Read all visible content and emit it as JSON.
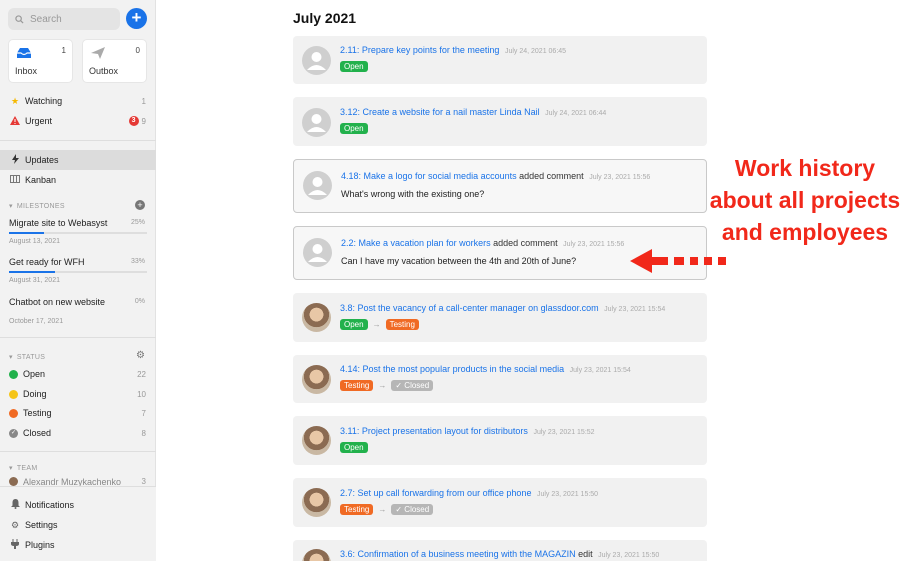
{
  "sidebar": {
    "search_placeholder": "Search",
    "add_label": "+",
    "inbox": {
      "label": "Inbox",
      "count": "1"
    },
    "outbox": {
      "label": "Outbox",
      "count": "0"
    },
    "watching": {
      "label": "Watching",
      "count": "1"
    },
    "urgent": {
      "label": "Urgent",
      "badge": "3",
      "count": "9"
    },
    "updates": {
      "label": "Updates"
    },
    "kanban": {
      "label": "Kanban"
    },
    "milestones_header": "MILESTONES",
    "milestones": [
      {
        "name": "Migrate site to Webasyst",
        "percent": "25%",
        "progress": 0.25,
        "date": "August 13, 2021"
      },
      {
        "name": "Get ready for WFH",
        "percent": "33%",
        "progress": 0.33,
        "date": "August 31, 2021"
      },
      {
        "name": "Chatbot on new website",
        "percent": "0%",
        "progress": 0,
        "date": "October 17, 2021"
      }
    ],
    "status_header": "STATUS",
    "statuses": [
      {
        "label": "Open",
        "count": "22",
        "color": "#22b14c"
      },
      {
        "label": "Doing",
        "count": "10",
        "color": "#f5c518"
      },
      {
        "label": "Testing",
        "count": "7",
        "color": "#f06a24"
      },
      {
        "label": "Closed",
        "count": "8",
        "color": "#888888"
      }
    ],
    "team_header": "TEAM",
    "team_partial": "Alexandr Muzykachenko",
    "team_partial_count": "3",
    "bottom": {
      "notifications": "Notifications",
      "settings": "Settings",
      "plugins": "Plugins"
    }
  },
  "main": {
    "title": "July 2021",
    "items": [
      {
        "link": "2.11: Prepare key points for the meeting",
        "action": "",
        "date": "July 24, 2021 06:45",
        "tags": [
          "Open"
        ],
        "comment": "",
        "avatar": "default"
      },
      {
        "link": "3.12: Create a website for a nail master Linda Nail",
        "action": "",
        "date": "July 24, 2021 06:44",
        "tags": [
          "Open"
        ],
        "comment": "",
        "avatar": "default"
      },
      {
        "link": "4.18: Make a logo for social media accounts",
        "action": "added comment",
        "date": "July 23, 2021 15:56",
        "tags": [],
        "comment": "What's wrong with the existing one?",
        "avatar": "default"
      },
      {
        "link": "2.2: Make a vacation plan for workers",
        "action": "added comment",
        "date": "July 23, 2021 15:56",
        "tags": [],
        "comment": "Can I have my vacation between the 4th and 20th of June?",
        "avatar": "default"
      },
      {
        "link": "3.8: Post the vacancy of a call-center manager on glassdoor.com",
        "action": "",
        "date": "July 23, 2021 15:54",
        "tags": [
          "Open",
          "Testing"
        ],
        "comment": "",
        "avatar": "photo"
      },
      {
        "link": "4.14: Post the most popular products in the social media",
        "action": "",
        "date": "July 23, 2021 15:54",
        "tags": [
          "Testing",
          "Closed"
        ],
        "comment": "",
        "avatar": "photo"
      },
      {
        "link": "3.11: Project presentation layout for distributors",
        "action": "",
        "date": "July 23, 2021 15:52",
        "tags": [
          "Open"
        ],
        "comment": "",
        "avatar": "photo"
      },
      {
        "link": "2.7: Set up call forwarding from our office phone",
        "action": "",
        "date": "July 23, 2021 15:50",
        "tags": [
          "Testing",
          "Closed"
        ],
        "comment": "",
        "avatar": "photo"
      },
      {
        "link": "3.6: Confirmation of a business meeting with the MAGAZIN",
        "action": "edit",
        "date": "July 23, 2021 15:50",
        "tags": [],
        "comment": "",
        "avatar": "photo"
      }
    ]
  },
  "annotation": {
    "lines": [
      "Work history",
      "about all projects",
      "and employees"
    ],
    "color": "#f1281a"
  }
}
